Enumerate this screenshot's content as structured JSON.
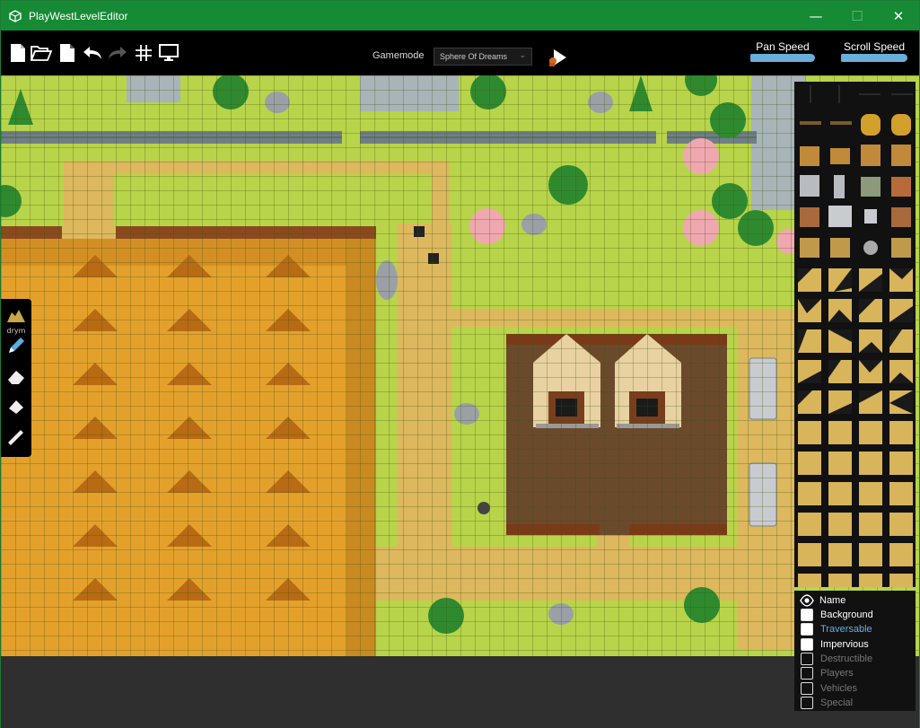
{
  "window": {
    "title": "PlayWestLevelEditor",
    "minimize": "—",
    "maximize": "☐",
    "close": "✕"
  },
  "toolbar": {
    "buttons": [
      "new-file-icon",
      "open-folder-icon",
      "save-file-icon",
      "undo-icon",
      "redo-icon",
      "grid-icon",
      "monitor-icon"
    ],
    "gamemode_label": "Gamemode",
    "gamemode_value": "Sphere Of Dreams",
    "pan_speed_label": "Pan Speed",
    "scroll_speed_label": "Scroll Speed",
    "pan_speed_level": 1.0,
    "scroll_speed_level": 1.0
  },
  "tools": {
    "brush_label": "drym",
    "items": [
      "tile-brush-icon",
      "pencil-icon",
      "eraser-icon",
      "fill-icon",
      "line-icon"
    ]
  },
  "layers": {
    "name_header": "Name",
    "items": [
      {
        "label": "Background",
        "checked": true,
        "color": "#ffffff"
      },
      {
        "label": "Traversable",
        "checked": true,
        "color": "#6aaedc"
      },
      {
        "label": "Impervious",
        "checked": true,
        "color": "#ffffff"
      },
      {
        "label": "Destructible",
        "checked": false,
        "color": "#777777"
      },
      {
        "label": "Players",
        "checked": false,
        "color": "#777777"
      },
      {
        "label": "Vehicles",
        "checked": false,
        "color": "#777777"
      },
      {
        "label": "Special",
        "checked": false,
        "color": "#777777"
      }
    ]
  },
  "colors": {
    "title_bar": "#168a34",
    "grass": "#b8d44a",
    "path": "#ddb85e",
    "wheat": "#e3a12c",
    "soil": "#6b4a2c",
    "accent": "#6aaedc"
  }
}
